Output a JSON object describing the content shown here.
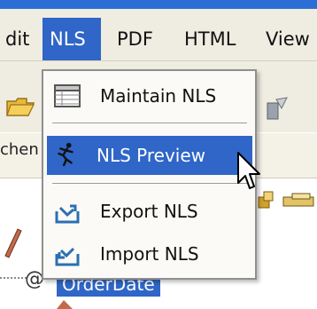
{
  "menubar": {
    "items": [
      {
        "label": "dit"
      },
      {
        "label": "NLS"
      },
      {
        "label": "PDF"
      },
      {
        "label": "HTML"
      },
      {
        "label": "View"
      }
    ]
  },
  "panel": {
    "tab_label": "chen"
  },
  "nls_menu": {
    "items": [
      {
        "label": "Maintain NLS",
        "icon": "table-icon"
      },
      {
        "label": "NLS Preview",
        "icon": "running-man-icon"
      },
      {
        "label": "Export NLS",
        "icon": "export-tray-icon"
      },
      {
        "label": "Import NLS",
        "icon": "import-tray-icon"
      }
    ]
  },
  "tree": {
    "at_symbol": "@",
    "selected_node": "OrderDate"
  },
  "colors": {
    "highlight": "#2f66c7",
    "menubar_bg": "#efece1",
    "top_strip": "#2b6fd6"
  }
}
